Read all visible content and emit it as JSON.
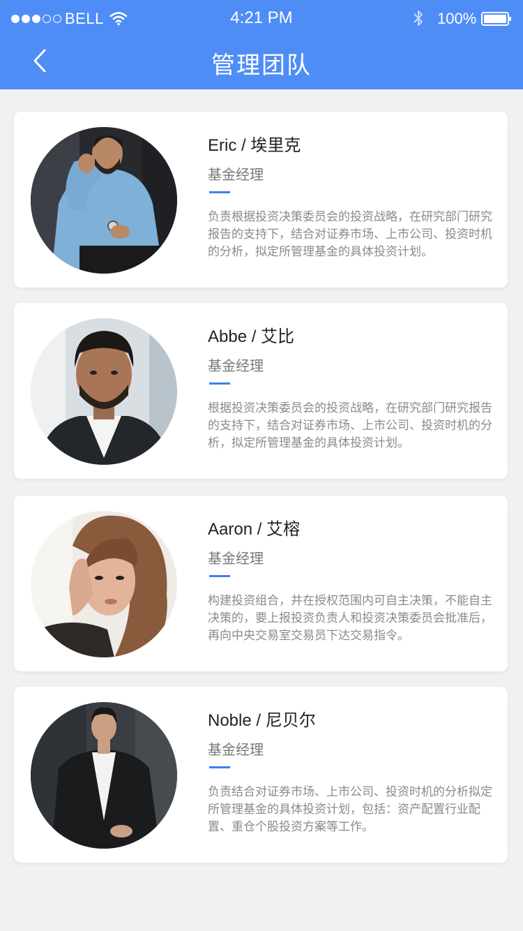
{
  "status_bar": {
    "carrier": "BELL",
    "time": "4:21 PM",
    "battery": "100%",
    "signal_filled": 3,
    "signal_total": 5
  },
  "nav": {
    "title": "管理团队",
    "back_icon": "chevron-left-icon"
  },
  "colors": {
    "header": "#4f8df6",
    "accent": "#3f7ef2",
    "background": "#f1f1f2"
  },
  "team": [
    {
      "name": "Eric / 埃里克",
      "role": "基金经理",
      "description": "负责根据投资决策委员会的投资战略，在研究部门研究报告的支持下，结合对证券市场、上市公司、投资时机的分析，拟定所管理基金的具体投资计划。"
    },
    {
      "name": "Abbe / 艾比",
      "role": "基金经理",
      "description": "根据投资决策委员会的投资战略，在研究部门研究报告的支持下，结合对证券市场、上市公司、投资时机的分析，拟定所管理基金的具体投资计划。"
    },
    {
      "name": "Aaron / 艾榕",
      "role": "基金经理",
      "description": "构建投资组合，并在授权范围内可自主决策，不能自主决策的，要上报投资负责人和投资决策委员会批准后，再向中央交易室交易员下达交易指令。"
    },
    {
      "name": "Noble / 尼贝尔",
      "role": "基金经理",
      "description": "负责结合对证券市场、上市公司、投资时机的分析拟定所管理基金的具体投资计划，包括：资产配置行业配置、重仓个股投资方案等工作。"
    }
  ]
}
